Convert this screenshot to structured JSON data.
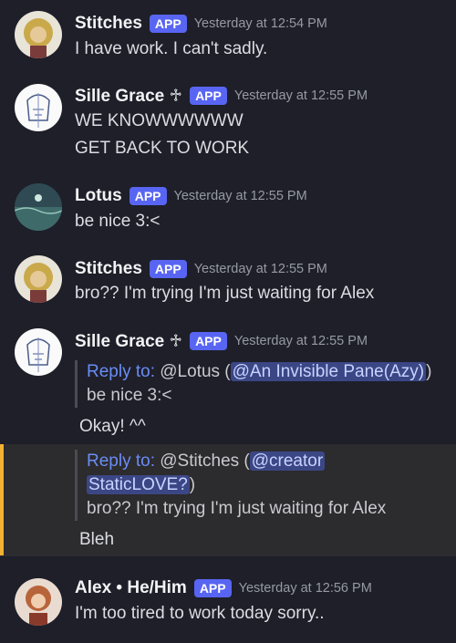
{
  "messages": [
    {
      "author": "Stitches",
      "badge": "APP",
      "time": "Yesterday at 12:54 PM",
      "lines": [
        "I have work. I can't sadly."
      ]
    },
    {
      "author": "Sille Grace ♱",
      "badge": "APP",
      "time": "Yesterday at 12:55 PM",
      "lines": [
        "WE KNOWWWWWW",
        "GET BACK TO WORK"
      ]
    },
    {
      "author": "Lotus",
      "badge": "APP",
      "time": "Yesterday at 12:55 PM",
      "lines": [
        "be nice 3:<"
      ]
    },
    {
      "author": "Stitches",
      "badge": "APP",
      "time": "Yesterday at 12:55 PM",
      "lines": [
        "bro?? I'm trying I'm just waiting for Alex"
      ]
    },
    {
      "author": "Sille Grace ♱",
      "badge": "APP",
      "time": "Yesterday at 12:55 PM",
      "reply1": {
        "label": "Reply to:",
        "target": "@Lotus (",
        "mention": "@An Invisible Pane(Azy)",
        "close": ")",
        "quote": "be nice 3:<"
      },
      "text1": "Okay! ^^",
      "reply2": {
        "label": "Reply to:",
        "target": "@Stitches (",
        "mention_a": "@creator",
        "mention_b": "StaticLOVE?",
        "close": ")",
        "quote": "bro?? I'm trying I'm just waiting for Alex"
      },
      "text2": "Bleh"
    },
    {
      "author": "Alex • He/Him",
      "badge": "APP",
      "time": "Yesterday at 12:56 PM",
      "lines": [
        "I'm too tired to work today sorry.."
      ]
    }
  ],
  "colors": {
    "background": "#1e1f29",
    "badge": "#5865f2",
    "highlight_bar": "#f0b232"
  }
}
